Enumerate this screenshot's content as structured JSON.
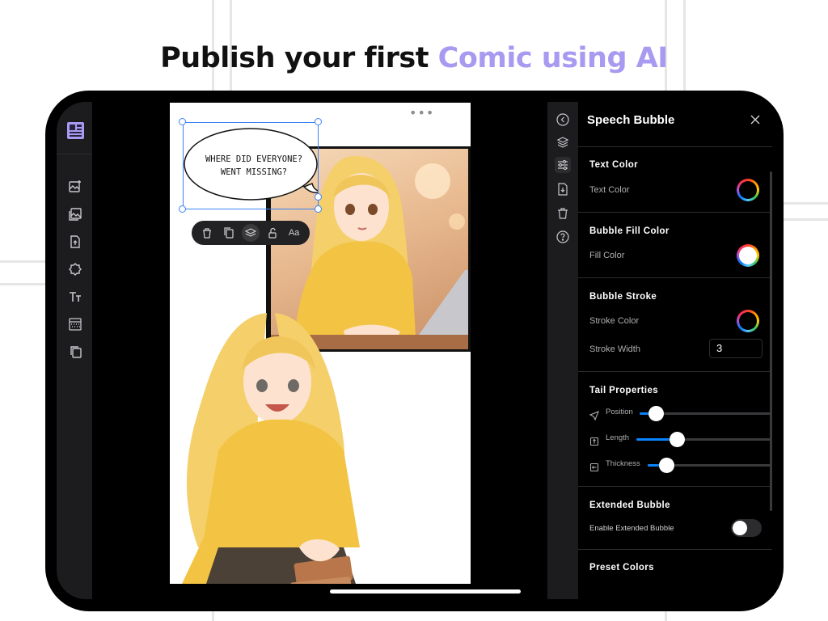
{
  "headline": {
    "part1": "Publish your first",
    "part2": "Comic using AI",
    "accent_color": "#a89af0"
  },
  "left_toolbar": {
    "logo": "layout-grid-icon",
    "items": [
      "add-image-icon",
      "gallery-icon",
      "upload-file-icon",
      "badge-shape-icon",
      "text-size-icon",
      "pattern-icon",
      "pages-icon"
    ]
  },
  "canvas": {
    "menu": "•••",
    "bubble": {
      "line1": "WHERE DID EVERYONE?",
      "line2": "WENT MISSING?"
    },
    "floating_toolbar": {
      "items": [
        "trash-icon",
        "duplicate-icon",
        "layers-icon",
        "unlock-icon"
      ],
      "font_label": "Aa"
    }
  },
  "right_rail": {
    "items": [
      "back-icon",
      "layers-icon",
      "adjust-sliders-icon",
      "export-page-icon",
      "trash-icon",
      "help-icon"
    ]
  },
  "properties": {
    "title": "Speech Bubble",
    "text_color": {
      "title": "Text Color",
      "label": "Text Color"
    },
    "fill_color": {
      "title": "Bubble Fill Color",
      "label": "Fill Color",
      "value": "#ffffff"
    },
    "stroke": {
      "title": "Bubble Stroke",
      "color_label": "Stroke Color",
      "width_label": "Stroke Width",
      "width_value": "3"
    },
    "tail": {
      "title": "Tail Properties",
      "position": {
        "label": "Position",
        "value": 0.12
      },
      "length": {
        "label": "Length",
        "value": 0.3
      },
      "thickness": {
        "label": "Thickness",
        "value": 0.15
      }
    },
    "extended": {
      "title": "Extended Bubble",
      "label": "Enable Extended Bubble",
      "enabled": false
    },
    "preset": {
      "title": "Preset Colors"
    }
  },
  "colors": {
    "slider_fill": "#0a84ff",
    "selection": "#3b82f6"
  }
}
